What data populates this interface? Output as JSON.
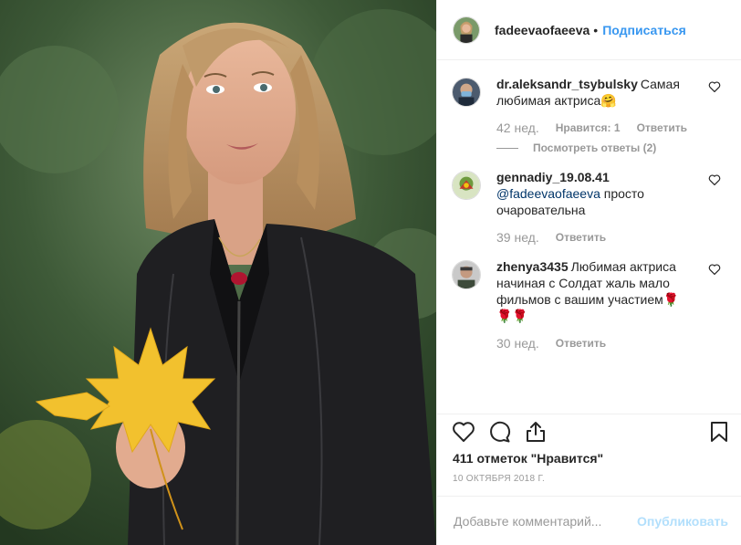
{
  "post": {
    "author": "fadeevaofaeeva",
    "separator": "•",
    "follow_label": "Подписаться",
    "likes_text": "411 отметок \"Нравится\"",
    "date": "10 октября 2018 г."
  },
  "comments": [
    {
      "user": "dr.aleksandr_tsybulsky",
      "text": "Самая любимая актриса🤗",
      "time": "42 нед.",
      "likes": "Нравится: 1",
      "reply": "Ответить",
      "view_replies": "Посмотреть ответы (2)"
    },
    {
      "user": "gennadiy_19.08.41",
      "mention": "@fadeevaofaeeva",
      "text": " просто очаровательна",
      "time": "39 нед.",
      "reply": "Ответить"
    },
    {
      "user": "zhenya3435",
      "text": "Любимая актриса начиная с Солдат жаль мало фильмов с вашим участием🌹🌹🌹",
      "time": "30 нед.",
      "reply": "Ответить"
    }
  ],
  "composer": {
    "placeholder": "Добавьте комментарий...",
    "publish_label": "Опубликовать"
  },
  "colors": {
    "accent": "#3897f0",
    "publish_disabled": "#b2dffc",
    "muted": "#999999",
    "text": "#262626"
  },
  "icons": [
    "heart-icon",
    "comment-icon",
    "share-icon",
    "bookmark-icon",
    "small-heart-icon"
  ]
}
